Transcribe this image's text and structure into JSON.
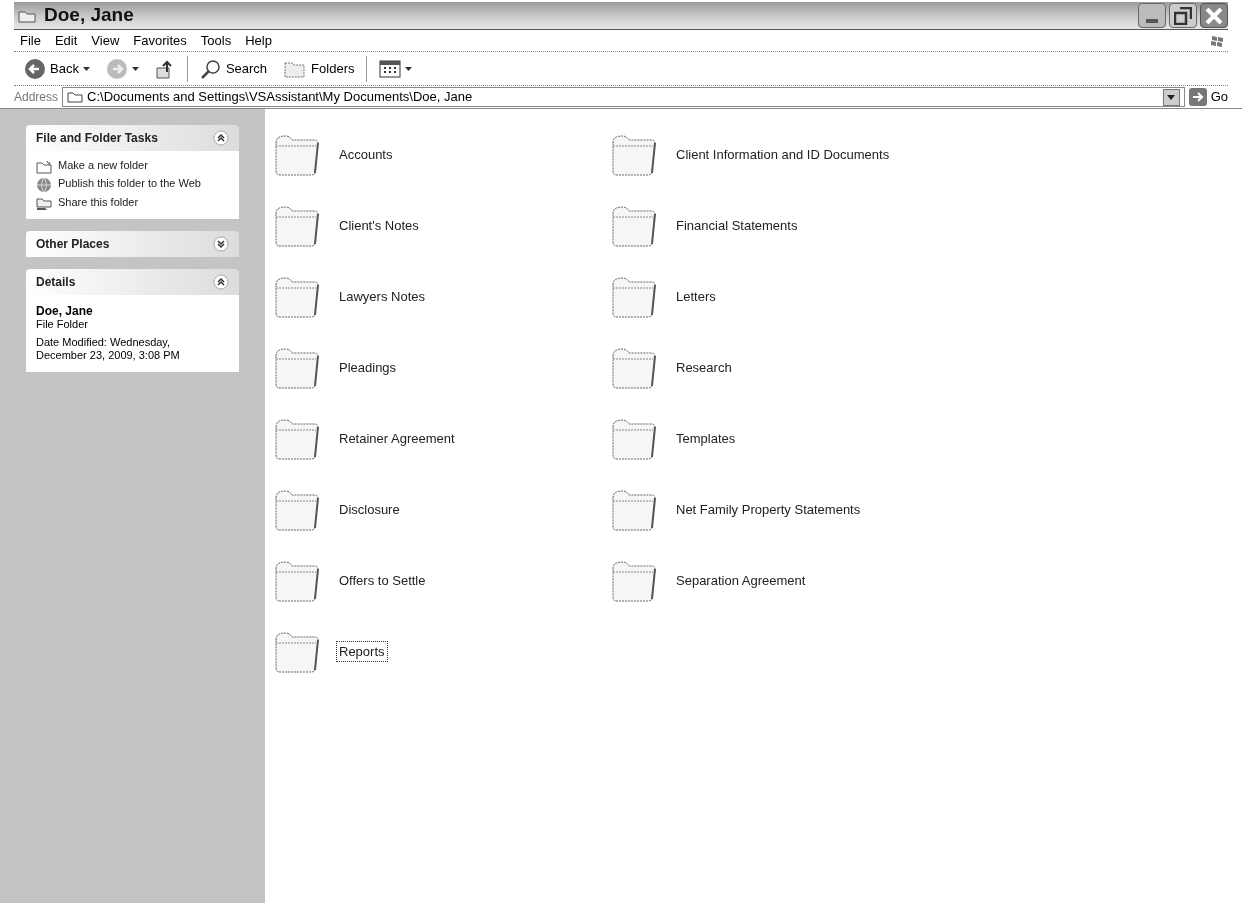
{
  "window": {
    "title": "Doe, Jane"
  },
  "menu": [
    "File",
    "Edit",
    "View",
    "Favorites",
    "Tools",
    "Help"
  ],
  "toolbar": [
    {
      "kind": "back",
      "label": "Back"
    },
    {
      "kind": "forward"
    },
    {
      "kind": "up"
    },
    {
      "kind": "search",
      "label": "Search"
    },
    {
      "kind": "folders",
      "label": "Folders"
    },
    {
      "kind": "views"
    }
  ],
  "address": {
    "label": "Address",
    "value": "C:\\Documents and Settings\\VSAssistant\\My Documents\\Doe, Jane",
    "go": "Go"
  },
  "sidebar": {
    "panels": [
      {
        "title": "File and Folder Tasks",
        "expanded": true,
        "kind": "tasks",
        "items": [
          {
            "label": "Make a new folder",
            "kind": "new-folder"
          },
          {
            "label": "Publish this folder to the Web",
            "kind": "globe"
          },
          {
            "label": "Share this folder",
            "kind": "share"
          }
        ]
      },
      {
        "title": "Other Places",
        "expanded": false
      },
      {
        "title": "Details",
        "expanded": true,
        "kind": "details",
        "name": "Doe, Jane",
        "type": "File Folder",
        "modified": "Date Modified: Wednesday, December 23, 2009, 3:08 PM"
      }
    ]
  },
  "folders": [
    {
      "name": "Accounts",
      "focused": false
    },
    {
      "name": "Client Information and ID Documents",
      "focused": false
    },
    {
      "name": "Client's Notes",
      "focused": false
    },
    {
      "name": "Financial Statements",
      "focused": false
    },
    {
      "name": "Lawyers Notes",
      "focused": false
    },
    {
      "name": "Letters",
      "focused": false
    },
    {
      "name": "Pleadings",
      "focused": false
    },
    {
      "name": "Research",
      "focused": false
    },
    {
      "name": "Retainer Agreement",
      "focused": false
    },
    {
      "name": "Templates",
      "focused": false
    },
    {
      "name": "Disclosure",
      "focused": false
    },
    {
      "name": "Net Family Property Statements",
      "focused": false
    },
    {
      "name": "Offers to Settle",
      "focused": false
    },
    {
      "name": "Separation Agreement",
      "focused": false
    },
    {
      "name": "Reports",
      "focused": true
    }
  ]
}
